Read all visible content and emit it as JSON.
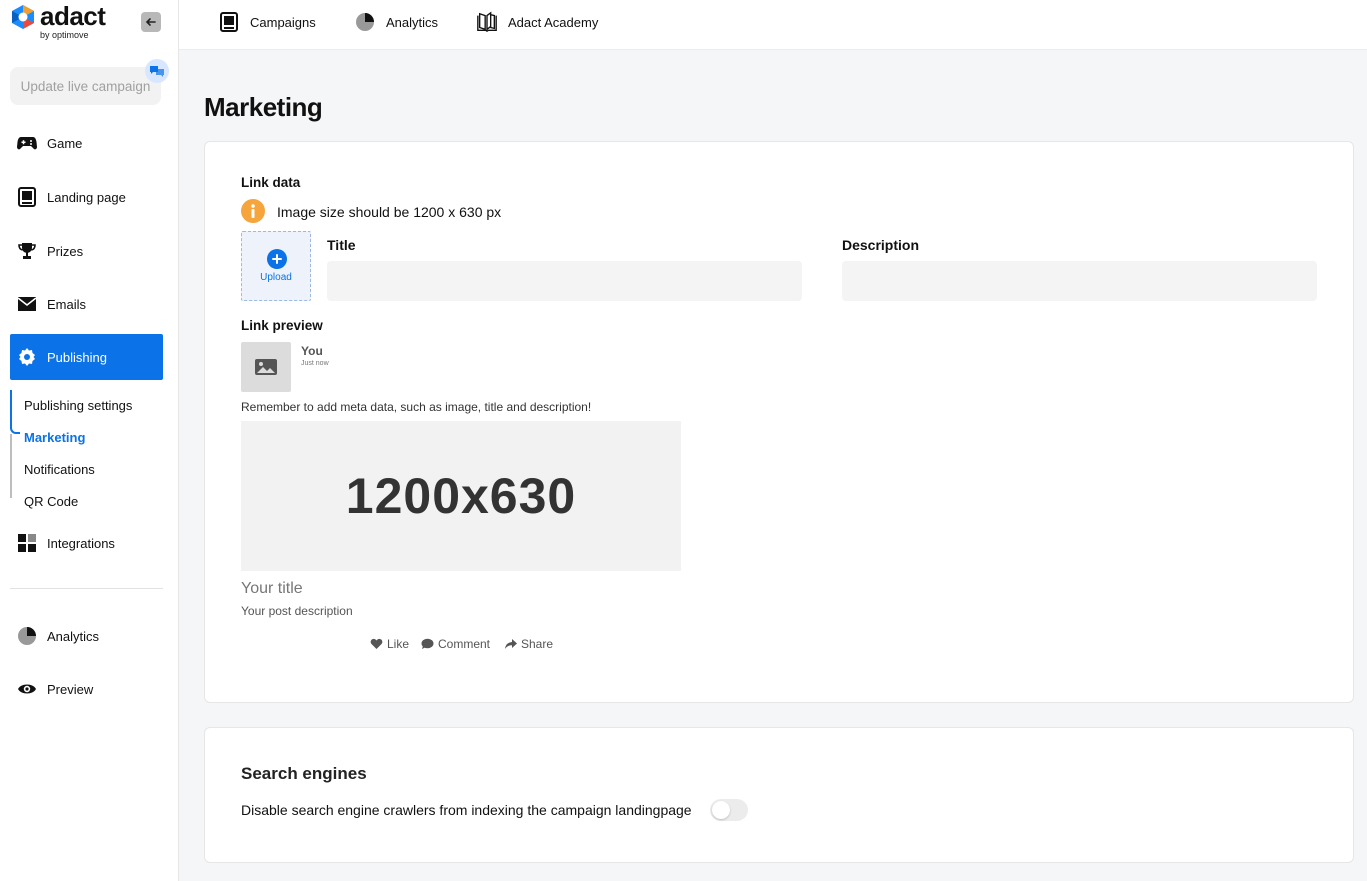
{
  "brand": {
    "name": "adact",
    "sub": "by optimove",
    "accent": "#0b72e7"
  },
  "sidebar": {
    "update_label": "Update live campaign",
    "items": [
      {
        "label": "Game",
        "icon": "gamepad-icon"
      },
      {
        "label": "Landing page",
        "icon": "landing-page-icon"
      },
      {
        "label": "Prizes",
        "icon": "trophy-icon"
      },
      {
        "label": "Emails",
        "icon": "envelope-icon"
      },
      {
        "label": "Publishing",
        "icon": "gear-icon",
        "active": true
      },
      {
        "label": "Integrations",
        "icon": "grid-icon"
      },
      {
        "label": "Analytics",
        "icon": "pie-chart-icon"
      },
      {
        "label": "Preview",
        "icon": "eye-icon"
      }
    ],
    "subitems": [
      {
        "label": "Publishing settings"
      },
      {
        "label": "Marketing",
        "active": true
      },
      {
        "label": "Notifications"
      },
      {
        "label": "QR Code"
      }
    ]
  },
  "topbar": {
    "items": [
      {
        "label": "Campaigns",
        "icon": "campaigns-icon"
      },
      {
        "label": "Analytics",
        "icon": "pie-chart-icon"
      },
      {
        "label": "Adact Academy",
        "icon": "book-icon"
      }
    ]
  },
  "page": {
    "title": "Marketing",
    "link_data": {
      "heading": "Link data",
      "info": "Image size should be 1200 x 630 px",
      "upload_label": "Upload",
      "title_label": "Title",
      "title_value": "",
      "description_label": "Description",
      "description_value": ""
    },
    "link_preview": {
      "heading": "Link preview",
      "user": "You",
      "time": "Just now",
      "remember": "Remember to add meta data, such as image, title and description!",
      "image_placeholder": "1200x630",
      "post_title": "Your title",
      "post_description": "Your post description",
      "actions": [
        "Like",
        "Comment",
        "Share"
      ]
    },
    "search_engines": {
      "heading": "Search engines",
      "disable_label": "Disable search engine crawlers from indexing the campaign landingpage",
      "enabled": false
    }
  }
}
